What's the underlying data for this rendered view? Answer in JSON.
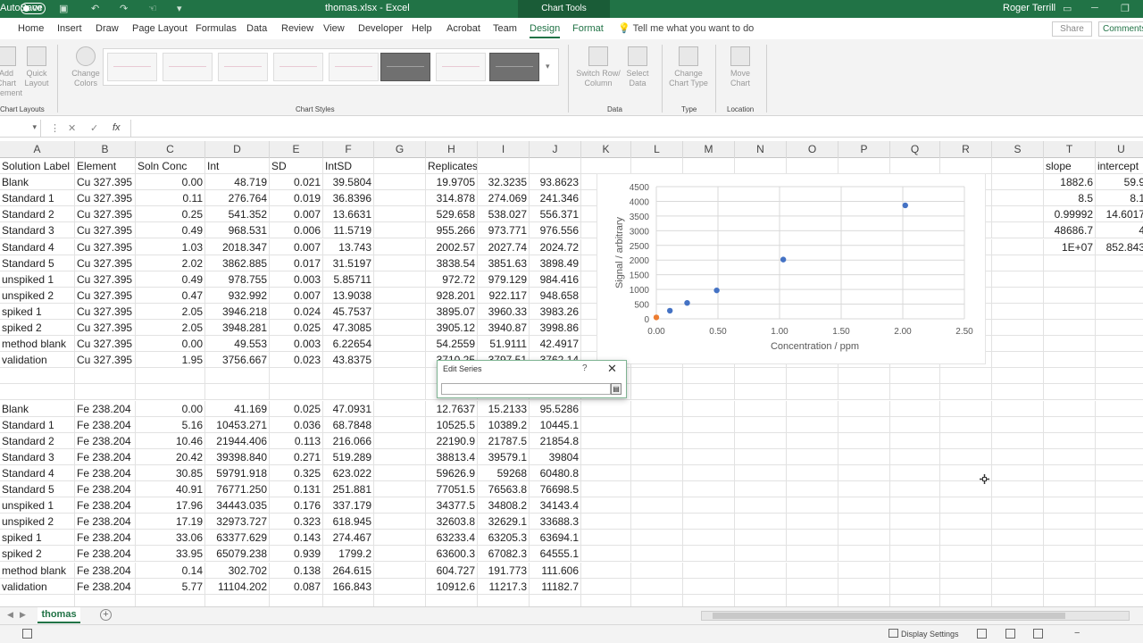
{
  "titlebar": {
    "autosave": "AutoSave",
    "autosave_state": "Off",
    "filename": "thomas.xlsx  -  Excel",
    "context": "Chart Tools",
    "user": "Roger Terrill"
  },
  "tabs": [
    "Home",
    "Insert",
    "Draw",
    "Page Layout",
    "Formulas",
    "Data",
    "Review",
    "View",
    "Developer",
    "Help",
    "Acrobat",
    "Team",
    "Design",
    "Format"
  ],
  "active_tab": "Design",
  "tellme": "Tell me what you want to do",
  "share": "Share",
  "comments": "Comments",
  "ribbon": {
    "add_chart_element": "Add Chart Element",
    "quick_layout": "Quick Layout",
    "change_colors": "Change Colors",
    "switch_row_col": "Switch Row/ Column",
    "select_data": "Select Data",
    "change_chart_type": "Change Chart Type",
    "move_chart": "Move Chart",
    "groups": {
      "chart_layouts": "Chart Layouts",
      "chart_styles": "Chart Styles",
      "data": "Data",
      "type": "Type",
      "location": "Location"
    }
  },
  "formula_bar": {
    "cancel": "✕",
    "enter": "✓",
    "fx": "fx"
  },
  "columns": [
    "A",
    "B",
    "C",
    "D",
    "E",
    "F",
    "G",
    "H",
    "I",
    "J",
    "K",
    "L",
    "M",
    "N",
    "O",
    "P",
    "Q",
    "R",
    "S",
    "T",
    "U"
  ],
  "headers": {
    "A": "Solution Label",
    "B": "Element",
    "C": "Soln Conc",
    "D": "Int",
    "E": "SD",
    "F": "IntSD",
    "H": "Replicates",
    "T": "slope",
    "U": "intercept"
  },
  "rows_cu": [
    [
      "Blank",
      "Cu 327.395",
      "0.00",
      "48.719",
      "0.021",
      "39.5804",
      "19.9705",
      "32.3235",
      "93.8623"
    ],
    [
      "Standard 1",
      "Cu 327.395",
      "0.11",
      "276.764",
      "0.019",
      "36.8396",
      "314.878",
      "274.069",
      "241.346"
    ],
    [
      "Standard 2",
      "Cu 327.395",
      "0.25",
      "541.352",
      "0.007",
      "13.6631",
      "529.658",
      "538.027",
      "556.371"
    ],
    [
      "Standard 3",
      "Cu 327.395",
      "0.49",
      "968.531",
      "0.006",
      "11.5719",
      "955.266",
      "973.771",
      "976.556"
    ],
    [
      "Standard 4",
      "Cu 327.395",
      "1.03",
      "2018.347",
      "0.007",
      "13.743",
      "2002.57",
      "2027.74",
      "2024.72"
    ],
    [
      "Standard 5",
      "Cu 327.395",
      "2.02",
      "3862.885",
      "0.017",
      "31.5197",
      "3838.54",
      "3851.63",
      "3898.49"
    ],
    [
      "unspiked 1",
      "Cu 327.395",
      "0.49",
      "978.755",
      "0.003",
      "5.85711",
      "972.72",
      "979.129",
      "984.416"
    ],
    [
      "unspiked 2",
      "Cu 327.395",
      "0.47",
      "932.992",
      "0.007",
      "13.9038",
      "928.201",
      "922.117",
      "948.658"
    ],
    [
      "spiked 1",
      "Cu 327.395",
      "2.05",
      "3946.218",
      "0.024",
      "45.7537",
      "3895.07",
      "3960.33",
      "3983.26"
    ],
    [
      "spiked 2",
      "Cu 327.395",
      "2.05",
      "3948.281",
      "0.025",
      "47.3085",
      "3905.12",
      "3940.87",
      "3998.86"
    ],
    [
      "method blank",
      "Cu 327.395",
      "0.00",
      "49.553",
      "0.003",
      "6.22654",
      "54.2559",
      "51.9111",
      "42.4917"
    ],
    [
      "validation",
      "Cu 327.395",
      "1.95",
      "3756.667",
      "0.023",
      "43.8375",
      "3710.25",
      "3797.51",
      "3762.14"
    ]
  ],
  "rows_fe": [
    [
      "Blank",
      "Fe 238.204",
      "0.00",
      "41.169",
      "0.025",
      "47.0931",
      "12.7637",
      "15.2133",
      "95.5286"
    ],
    [
      "Standard 1",
      "Fe 238.204",
      "5.16",
      "10453.271",
      "0.036",
      "68.7848",
      "10525.5",
      "10389.2",
      "10445.1"
    ],
    [
      "Standard 2",
      "Fe 238.204",
      "10.46",
      "21944.406",
      "0.113",
      "216.066",
      "22190.9",
      "21787.5",
      "21854.8"
    ],
    [
      "Standard 3",
      "Fe 238.204",
      "20.42",
      "39398.840",
      "0.271",
      "519.289",
      "38813.4",
      "39579.1",
      "39804"
    ],
    [
      "Standard 4",
      "Fe 238.204",
      "30.85",
      "59791.918",
      "0.325",
      "623.022",
      "59626.9",
      "59268",
      "60480.8"
    ],
    [
      "Standard 5",
      "Fe 238.204",
      "40.91",
      "76771.250",
      "0.131",
      "251.881",
      "77051.5",
      "76563.8",
      "76698.5"
    ],
    [
      "unspiked 1",
      "Fe 238.204",
      "17.96",
      "34443.035",
      "0.176",
      "337.179",
      "34377.5",
      "34808.2",
      "34143.4"
    ],
    [
      "unspiked 2",
      "Fe 238.204",
      "17.19",
      "32973.727",
      "0.323",
      "618.945",
      "32603.8",
      "32629.1",
      "33688.3"
    ],
    [
      "spiked 1",
      "Fe 238.204",
      "33.06",
      "63377.629",
      "0.143",
      "274.467",
      "63233.4",
      "63205.3",
      "63694.1"
    ],
    [
      "spiked 2",
      "Fe 238.204",
      "33.95",
      "65079.238",
      "0.939",
      "1799.2",
      "63600.3",
      "67082.3",
      "64555.1"
    ],
    [
      "method blank",
      "Fe 238.204",
      "0.14",
      "302.702",
      "0.138",
      "264.615",
      "604.727",
      "191.773",
      "111.606"
    ],
    [
      "validation",
      "Fe 238.204",
      "5.77",
      "11104.202",
      "0.087",
      "166.843",
      "10912.6",
      "11217.3",
      "11182.7"
    ]
  ],
  "linest": [
    [
      "1882.6",
      "59.9"
    ],
    [
      "8.5",
      "8.1"
    ],
    [
      "0.99992",
      "14.6017"
    ],
    [
      "48686.7",
      "4"
    ],
    [
      "1E+07",
      "852.843"
    ]
  ],
  "chart_data": {
    "type": "scatter",
    "xlabel": "Concentration / ppm",
    "ylabel": "Signal / arbitrary",
    "xlim": [
      0,
      2.5
    ],
    "ylim": [
      0,
      4500
    ],
    "xticks": [
      "0.00",
      "0.50",
      "1.00",
      "1.50",
      "2.00",
      "2.50"
    ],
    "yticks": [
      "0",
      "500",
      "1000",
      "1500",
      "2000",
      "2500",
      "3000",
      "3500",
      "4000",
      "4500"
    ],
    "series": [
      {
        "color": "#4472c4",
        "points": [
          [
            0.11,
            276.8
          ],
          [
            0.25,
            541.4
          ],
          [
            0.49,
            968.5
          ],
          [
            1.03,
            2018.3
          ],
          [
            2.02,
            3862.9
          ]
        ]
      },
      {
        "color": "#ed7d31",
        "points": [
          [
            0.0,
            48.7
          ]
        ]
      }
    ]
  },
  "dialog": {
    "title": "Edit Series",
    "help": "?",
    "close": "✕"
  },
  "sheet_tab": "thomas",
  "status": {
    "display_settings": "Display Settings"
  }
}
